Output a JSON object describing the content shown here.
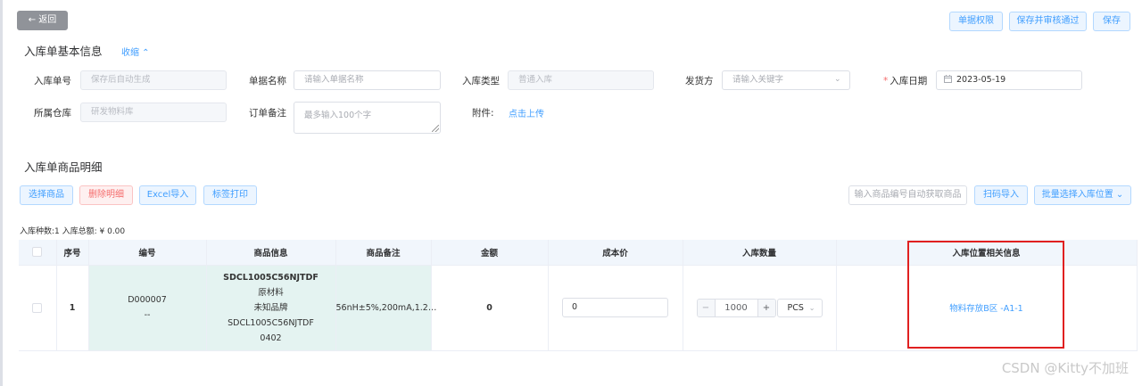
{
  "toolbar": {
    "back_label": "← 返回",
    "permission_label": "单据权限",
    "save_audit_label": "保存并审核通过",
    "save_label": "保存"
  },
  "basic_section": {
    "title": "入库单基本信息",
    "collapse_label": "收缩 ⌃"
  },
  "form": {
    "order_no": {
      "label": "入库单号",
      "value": "保存后自动生成"
    },
    "doc_name": {
      "label": "单据名称",
      "placeholder": "请输入单据名称"
    },
    "in_type": {
      "label": "入库类型",
      "value": "普通入库"
    },
    "shipper": {
      "label": "发货方",
      "placeholder": "请输入关键字"
    },
    "in_date": {
      "required_mark": "*",
      "label": "入库日期",
      "value": "2023-05-19"
    },
    "warehouse": {
      "label": "所属仓库",
      "value": "研发物料库"
    },
    "remark": {
      "label": "订单备注",
      "placeholder": "最多输入100个字"
    },
    "attachment": {
      "label": "附件:",
      "upload_label": "点击上传"
    }
  },
  "detail_section": {
    "title": "入库单商品明细",
    "buttons": {
      "select_goods": "选择商品",
      "delete_detail": "删除明细",
      "excel_import": "Excel导入",
      "label_print": "标签打印",
      "code_input_placeholder": "输入商品编号自动获取商品",
      "scan_import": "扫码导入",
      "batch_location": "批量选择入库位置 ⌄"
    },
    "summary": "入库种数:1   入库总额: ¥ 0.00"
  },
  "table": {
    "headers": [
      "",
      "序号",
      "编号",
      "商品信息",
      "商品备注",
      "金额",
      "成本价",
      "入库数量",
      "入库位置相关信息",
      ""
    ],
    "rows": [
      {
        "seq": "1",
        "code": "D000007",
        "code_sub": "--",
        "product_name": "SDCL1005C56NJTDF",
        "product_type": "原材料",
        "product_brand": "未知品牌",
        "product_model": "SDCL1005C56NJTDF",
        "product_package": "0402",
        "product_remark": "56nH±5%,200mA,1.2…",
        "amount": "0",
        "cost_price": "0",
        "quantity": "1000",
        "unit": "PCS",
        "location": "物料存放B区 -A1-1"
      }
    ]
  },
  "watermark": "CSDN @Kitty不加班",
  "icons": {
    "calendar": "calendar-icon",
    "dropdown": "chevron-down-icon"
  },
  "colors": {
    "primary": "#409eff",
    "danger": "#f56c6c",
    "highlight_box": "#e02020"
  }
}
